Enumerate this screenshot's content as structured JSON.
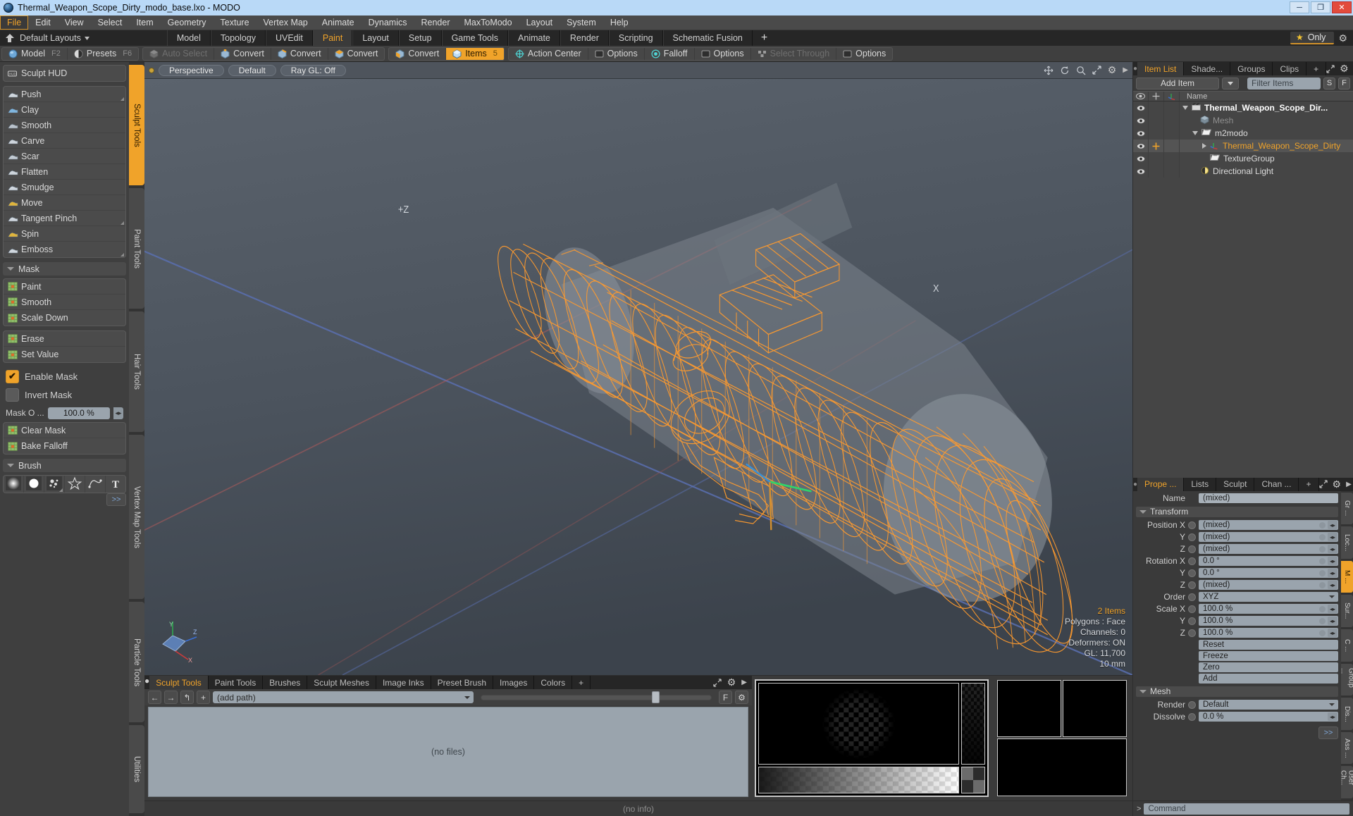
{
  "window": {
    "title": "Thermal_Weapon_Scope_Dirty_modo_base.lxo - MODO",
    "minimize": "─",
    "maximize": "❐",
    "close": "✕"
  },
  "menubar": {
    "items": [
      {
        "label": "File",
        "active": true
      },
      {
        "label": "Edit",
        "active": false
      },
      {
        "label": "View",
        "active": false
      },
      {
        "label": "Select",
        "active": false
      },
      {
        "label": "Item",
        "active": false
      },
      {
        "label": "Geometry",
        "active": false
      },
      {
        "label": "Texture",
        "active": false
      },
      {
        "label": "Vertex Map",
        "active": false
      },
      {
        "label": "Animate",
        "active": false
      },
      {
        "label": "Dynamics",
        "active": false
      },
      {
        "label": "Render",
        "active": false
      },
      {
        "label": "MaxToModo",
        "active": false
      },
      {
        "label": "Layout",
        "active": false
      },
      {
        "label": "System",
        "active": false
      },
      {
        "label": "Help",
        "active": false
      }
    ]
  },
  "layoutbar": {
    "dropdown_label": "Default Layouts",
    "tabs": [
      {
        "label": "Model",
        "active": false
      },
      {
        "label": "Topology",
        "active": false
      },
      {
        "label": "UVEdit",
        "active": false
      },
      {
        "label": "Paint",
        "active": true
      },
      {
        "label": "Layout",
        "active": false
      },
      {
        "label": "Setup",
        "active": false
      },
      {
        "label": "Game Tools",
        "active": false
      },
      {
        "label": "Animate",
        "active": false
      },
      {
        "label": "Render",
        "active": false
      },
      {
        "label": "Scripting",
        "active": false
      },
      {
        "label": "Schematic Fusion",
        "active": false
      }
    ],
    "add_label": "+",
    "only_label": "Only"
  },
  "modebar": {
    "group1": [
      {
        "label": "Model",
        "key": "F2",
        "state": "normal",
        "icon": "sphere-icon"
      },
      {
        "label": "Presets",
        "key": "F6",
        "state": "normal",
        "icon": "half-sphere-icon"
      }
    ],
    "group2": [
      {
        "label": "Auto Select",
        "key": "",
        "state": "disabled",
        "icon": "cube-gray-icon"
      },
      {
        "label": "Convert",
        "key": "",
        "state": "normal",
        "icon": "cube-vertex-icon"
      },
      {
        "label": "Convert",
        "key": "",
        "state": "normal",
        "icon": "cube-edge-icon"
      },
      {
        "label": "Convert",
        "key": "",
        "state": "normal",
        "icon": "cube-poly-icon"
      }
    ],
    "group3": [
      {
        "label": "Convert",
        "key": "",
        "state": "normal",
        "icon": "cube-material-icon"
      },
      {
        "label": "Items",
        "key": "5",
        "state": "on",
        "icon": "cube-blue-icon"
      }
    ],
    "group4": [
      {
        "label": "Action Center",
        "key": "",
        "state": "normal",
        "icon": "crosshair-icon"
      },
      {
        "label": "Options",
        "key": "",
        "state": "normal",
        "icon": "square-icon"
      },
      {
        "label": "Falloff",
        "key": "",
        "state": "normal",
        "icon": "target-icon"
      },
      {
        "label": "Options",
        "key": "",
        "state": "normal",
        "icon": "square-icon"
      },
      {
        "label": "Select Through",
        "key": "",
        "state": "disabled",
        "icon": "cluster-icon"
      },
      {
        "label": "Options",
        "key": "",
        "state": "normal",
        "icon": "square-icon"
      }
    ]
  },
  "left_panel": {
    "hud": {
      "label": "Sculpt HUD",
      "icon": "hud-icon"
    },
    "sculpt_tools": [
      {
        "label": "Push",
        "icon": "push-brush-icon",
        "corner": true
      },
      {
        "label": "Clay",
        "icon": "clay-brush-icon",
        "corner": false
      },
      {
        "label": "Smooth",
        "icon": "smooth-brush-icon",
        "corner": false
      },
      {
        "label": "Carve",
        "icon": "carve-brush-icon",
        "corner": false
      },
      {
        "label": "Scar",
        "icon": "scar-brush-icon",
        "corner": false
      },
      {
        "label": "Flatten",
        "icon": "flatten-brush-icon",
        "corner": false
      },
      {
        "label": "Smudge",
        "icon": "smudge-brush-icon",
        "corner": false
      },
      {
        "label": "Move",
        "icon": "move-brush-icon",
        "corner": false
      },
      {
        "label": "Tangent Pinch",
        "icon": "pinch-brush-icon",
        "corner": true
      },
      {
        "label": "Spin",
        "icon": "spin-brush-icon",
        "corner": false
      },
      {
        "label": "Emboss",
        "icon": "emboss-brush-icon",
        "corner": true
      }
    ],
    "mask_section": {
      "label": "Mask"
    },
    "mask_tools": [
      {
        "label": "Paint",
        "icon": "mask-paint-icon"
      },
      {
        "label": "Smooth",
        "icon": "mask-smooth-icon"
      },
      {
        "label": "Scale Down",
        "icon": "mask-scaledown-icon"
      }
    ],
    "mask_tools2": [
      {
        "label": "Erase",
        "icon": "mask-erase-icon"
      },
      {
        "label": "Set Value",
        "icon": "mask-setvalue-icon"
      }
    ],
    "enable_mask": {
      "label": "Enable Mask",
      "checked": true
    },
    "invert_mask": {
      "label": "Invert Mask",
      "checked": false
    },
    "mask_opacity": {
      "label": "Mask O ...",
      "value": "100.0 %"
    },
    "mask_actions": [
      {
        "label": "Clear Mask",
        "icon": "clear-mask-icon"
      },
      {
        "label": "Bake Falloff",
        "icon": "bake-falloff-icon"
      }
    ],
    "brush_section": {
      "label": "Brush"
    },
    "brush_presets": [
      {
        "icon": "soft-brush-icon"
      },
      {
        "icon": "hard-brush-icon"
      },
      {
        "icon": "noise-brush-icon"
      },
      {
        "icon": "star-brush-icon"
      },
      {
        "icon": "curve-brush-icon"
      },
      {
        "icon": "text-brush-icon"
      }
    ],
    "more_label": ">>",
    "vtabs": [
      {
        "label": "Sculpt Tools",
        "active": true
      },
      {
        "label": "Paint Tools",
        "active": false
      },
      {
        "label": "Hair Tools",
        "active": false
      },
      {
        "label": "Vertex Map Tools",
        "active": false
      },
      {
        "label": "Particle Tools",
        "active": false
      },
      {
        "label": "Utilities",
        "active": false
      }
    ]
  },
  "viewport": {
    "header": {
      "view_mode": "Perspective",
      "shading": "Default",
      "raygl": "Ray GL: Off",
      "icons": [
        "move-icon",
        "rotate-icon",
        "zoom-icon",
        "expand-icon",
        "gear-icon",
        "play-icon"
      ]
    },
    "info": {
      "items": "2 Items",
      "polygons": "Polygons : Face",
      "channels": "Channels: 0",
      "deformers": "Deformers: ON",
      "gl": "GL: 11,700",
      "grid": "10 mm"
    },
    "axis_labels": {
      "x": "X",
      "y": "Y",
      "z": "Z",
      "plus_z": "+Z"
    }
  },
  "bottom_dock": {
    "tabs": [
      {
        "label": "Sculpt Tools",
        "active": true
      },
      {
        "label": "Paint Tools",
        "active": false
      },
      {
        "label": "Brushes",
        "active": false
      },
      {
        "label": "Sculpt Meshes",
        "active": false
      },
      {
        "label": "Image Inks",
        "active": false
      },
      {
        "label": "Preset Brush",
        "active": false
      },
      {
        "label": "Images",
        "active": false
      },
      {
        "label": "Colors",
        "active": false
      }
    ],
    "add_label": "+",
    "nav": {
      "back": "←",
      "forward": "→",
      "up": "↰",
      "add": "+"
    },
    "path_placeholder": "(add path)",
    "file_area_text": "(no files)",
    "f_button": "F",
    "status_text": "(no info)"
  },
  "right_panel": {
    "top_tabs": [
      {
        "label": "Item List",
        "active": true
      },
      {
        "label": "Shade...",
        "active": false
      },
      {
        "label": "Groups",
        "active": false
      },
      {
        "label": "Clips",
        "active": false
      }
    ],
    "top_add": "+",
    "add_item_label": "Add Item",
    "filter_placeholder": "Filter Items",
    "filter_s": "S",
    "filter_f": "F",
    "list_headers": {
      "name": "Name"
    },
    "items": [
      {
        "label": "Thermal_Weapon_Scope_Dir...",
        "icon": "scene-icon",
        "indent": 0,
        "bold": true,
        "dim": false,
        "selected": false,
        "expander": "down"
      },
      {
        "label": "Mesh",
        "icon": "mesh-icon",
        "indent": 1,
        "bold": false,
        "dim": true,
        "selected": false,
        "expander": "none"
      },
      {
        "label": "m2modo",
        "icon": "folder-icon",
        "indent": 1,
        "bold": false,
        "dim": false,
        "selected": false,
        "expander": "down"
      },
      {
        "label": "Thermal_Weapon_Scope_Dirty",
        "icon": "locator-icon",
        "indent": 2,
        "bold": false,
        "dim": false,
        "selected": true,
        "expander": "right"
      },
      {
        "label": "TextureGroup",
        "icon": "folder-icon",
        "indent": 2,
        "bold": false,
        "dim": false,
        "selected": false,
        "expander": "none"
      },
      {
        "label": "Directional Light",
        "icon": "light-icon",
        "indent": 1,
        "bold": false,
        "dim": false,
        "selected": false,
        "expander": "none"
      }
    ],
    "prop_tabs": [
      {
        "label": "Prope ...",
        "active": true
      },
      {
        "label": "Lists",
        "active": false
      },
      {
        "label": "Sculpt",
        "active": false
      },
      {
        "label": "Chan ...",
        "active": false
      }
    ],
    "prop_add": "+",
    "name_label": "Name",
    "name_value": "(mixed)",
    "transform_section": "Transform",
    "transform_rows": [
      {
        "label": "Position X",
        "value": "(mixed)",
        "type": "spin"
      },
      {
        "label": "Y",
        "value": "(mixed)",
        "type": "spin"
      },
      {
        "label": "Z",
        "value": "(mixed)",
        "type": "spin"
      },
      {
        "label": "Rotation X",
        "value": "0.0 °",
        "type": "spin"
      },
      {
        "label": "Y",
        "value": "0.0 °",
        "type": "spin"
      },
      {
        "label": "Z",
        "value": "(mixed)",
        "type": "spin"
      },
      {
        "label": "Order",
        "value": "XYZ",
        "type": "dropdown"
      },
      {
        "label": "Scale X",
        "value": "100.0 %",
        "type": "spin"
      },
      {
        "label": "Y",
        "value": "100.0 %",
        "type": "spin"
      },
      {
        "label": "Z",
        "value": "100.0 %",
        "type": "spin"
      }
    ],
    "transform_actions": [
      {
        "label": "Reset"
      },
      {
        "label": "Freeze"
      },
      {
        "label": "Zero"
      },
      {
        "label": "Add"
      }
    ],
    "mesh_section": "Mesh",
    "mesh_rows": [
      {
        "label": "Render",
        "value": "Default",
        "type": "dropdown"
      },
      {
        "label": "Dissolve",
        "value": "0.0 %",
        "type": "spin"
      }
    ],
    "side_tabs": [
      {
        "label": "Gr ...",
        "active": false
      },
      {
        "label": "Loc...",
        "active": false
      },
      {
        "label": "M ...",
        "active": true
      },
      {
        "label": "Sur...",
        "active": false
      },
      {
        "label": "C ...",
        "active": false
      },
      {
        "label": "Group ...",
        "active": false
      },
      {
        "label": "Dis...",
        "active": false
      },
      {
        "label": "Ass ...",
        "active": false
      },
      {
        "label": "User Ch...",
        "active": false
      }
    ],
    "expand_label": ">>",
    "command_placeholder": "Command"
  },
  "colors": {
    "accent": "#f0a32a",
    "titlebar": "#b9d9f7",
    "panel": "#3a3a3a",
    "wireframe": "#ff9b2e",
    "field": "#9aa4ad"
  }
}
